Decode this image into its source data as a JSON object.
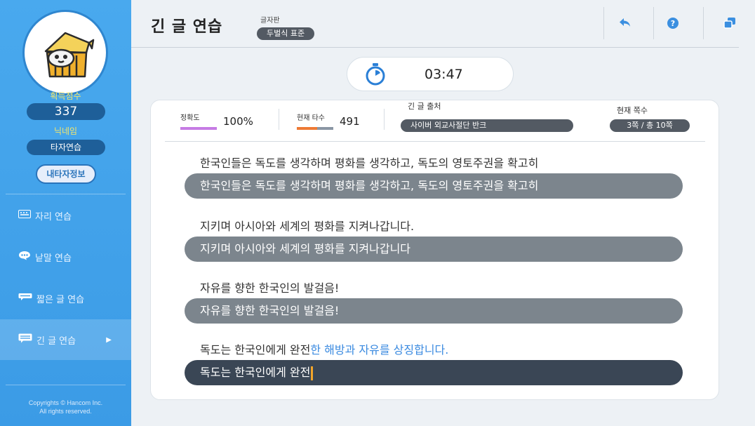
{
  "sidebar": {
    "score_label": "획득점수",
    "score_value": "337",
    "nickname_label": "닉네임",
    "nickname_value": "타자연습",
    "my_info_button": "내타자정보",
    "nav": [
      {
        "label": "자리 연습",
        "icon": "keyboard-icon"
      },
      {
        "label": "낱말 연습",
        "icon": "speech-bubble-icon"
      },
      {
        "label": "짧은 글 연습",
        "icon": "short-text-icon"
      },
      {
        "label": "긴 글 연습",
        "icon": "long-text-icon",
        "active": true
      }
    ],
    "copyright_line1": "Copyrights © Hancom Inc.",
    "copyright_line2": "All rights reserved."
  },
  "header": {
    "title": "긴 글 연습",
    "layout_label": "글자판",
    "layout_value": "두벌식 표준",
    "buttons": [
      "back-icon",
      "help-icon",
      "window-icon"
    ]
  },
  "timer": {
    "time": "03:47"
  },
  "stats": {
    "accuracy_label": "정확도",
    "accuracy_value": "100%",
    "speed_label": "현재 타수",
    "speed_value": "491",
    "speed_bar_fraction": 0.55,
    "source_label": "긴 글 출처",
    "source_value": "사이버 외교사절단 반크",
    "page_label": "현재 쪽수",
    "page_value": "3쪽 / 총 10쪽"
  },
  "lines": [
    {
      "source": "한국인들은 독도를 생각하며 평화를 생각하고, 독도의 영토주권을 확고히",
      "typed": "한국인들은 독도를 생각하며 평화를 생각하고, 독도의 영토주권을 확고히"
    },
    {
      "source": "지키며 아시아와 세계의 평화를 지켜나갑니다.",
      "typed": "지키며 아시아와 세계의 평화를 지켜나갑니다"
    },
    {
      "source": "자유를 향한 한국인의 발걸음!",
      "typed": "자유를 향한 한국인의 발걸음!"
    },
    {
      "source_done": "독도는 한국인에게 완전",
      "source_todo": "한 해방과 자유를 상징합니다.",
      "typed": "독도는 한국인에게 완전"
    }
  ],
  "colors": {
    "sidebar": "#3b9be6",
    "accent_yellow": "#f4e66b",
    "accuracy_bar": "#c67be4",
    "speed_bar": "#ee7a35",
    "pending_text": "#3a8ae0"
  }
}
